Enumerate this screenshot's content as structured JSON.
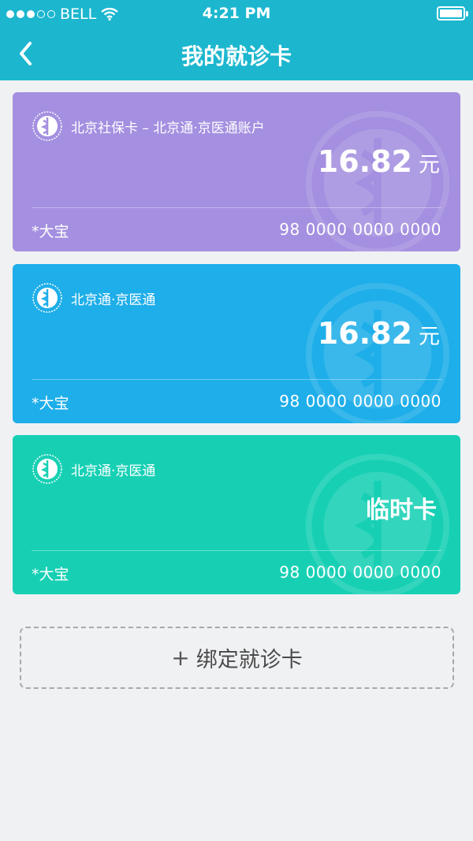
{
  "status_bar": {
    "carrier": "BELL",
    "time": "4:21 PM"
  },
  "nav": {
    "title": "我的就诊卡"
  },
  "cards": [
    {
      "title": "北京社保卡 – 北京通·京医通账户",
      "amount": "16.82",
      "unit": "元",
      "holder": "*大宝",
      "number": "98 0000 0000 0000",
      "color": "#a48fe0"
    },
    {
      "title": "北京通·京医通",
      "amount": "16.82",
      "unit": "元",
      "holder": "*大宝",
      "number": "98 0000 0000 0000",
      "color": "#1eaee9"
    },
    {
      "title": "北京通·京医通",
      "status": "临时卡",
      "holder": "*大宝",
      "number": "98 0000 0000 0000",
      "color": "#17d0b4"
    }
  ],
  "bind_button": {
    "plus": "+",
    "label": "绑定就诊卡"
  }
}
